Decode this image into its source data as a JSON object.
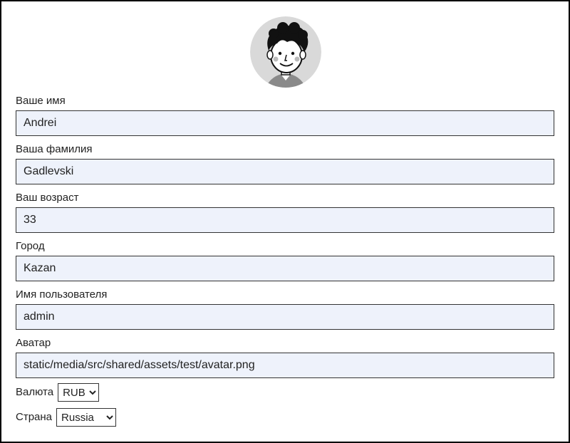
{
  "profile": {
    "first_name": {
      "label": "Ваше имя",
      "value": "Andrei"
    },
    "last_name": {
      "label": "Ваша фамилия",
      "value": "Gadlevski"
    },
    "age": {
      "label": "Ваш возраст",
      "value": "33"
    },
    "city": {
      "label": "Город",
      "value": "Kazan"
    },
    "username": {
      "label": "Имя пользователя",
      "value": "admin"
    },
    "avatar": {
      "label": "Аватар",
      "value": "static/media/src/shared/assets/test/avatar.png"
    },
    "currency": {
      "label": "Валюта",
      "selected": "RUB"
    },
    "country": {
      "label": "Страна",
      "selected": "Russia"
    }
  },
  "colors": {
    "input_bg": "#eef2fb",
    "avatar_bg": "#d9d9d9"
  },
  "icons": {
    "avatar": "avatar-image"
  }
}
